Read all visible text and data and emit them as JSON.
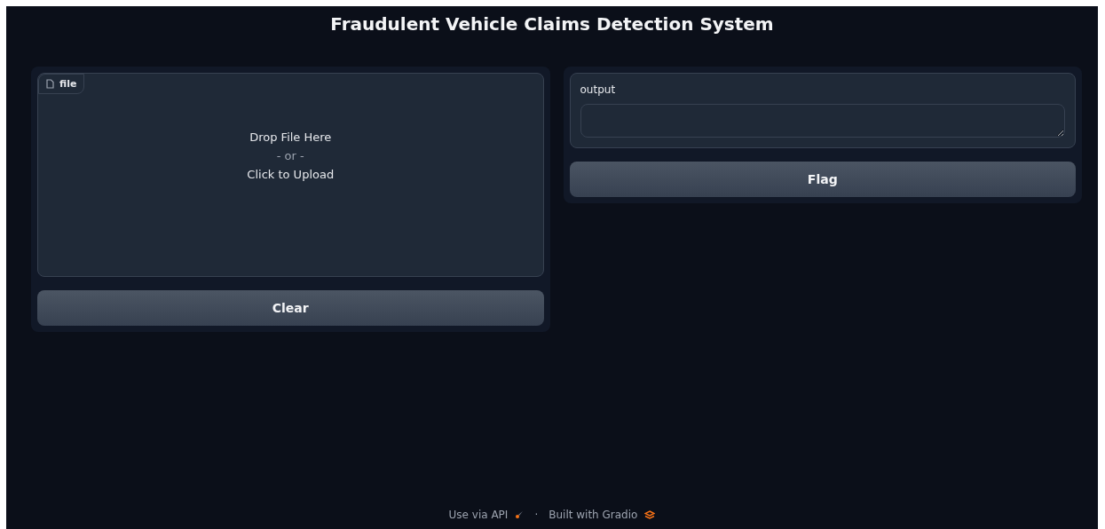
{
  "title": "Fraudulent Vehicle Claims Detection System",
  "input": {
    "label": "file",
    "drop_text": "Drop File Here",
    "separator": "- or -",
    "click_text": "Click to Upload",
    "button": "Clear"
  },
  "output": {
    "label": "output",
    "button": "Flag"
  },
  "footer": {
    "api_link": "Use via API",
    "separator": "·",
    "built_with": "Built with Gradio"
  }
}
